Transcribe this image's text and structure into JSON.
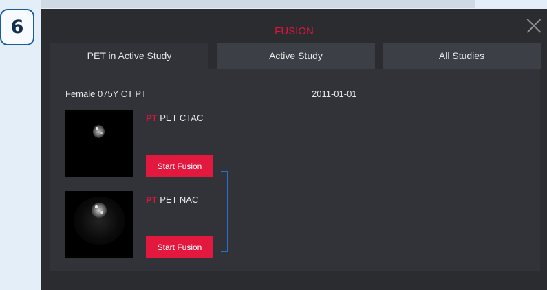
{
  "step": {
    "number": "6"
  },
  "dialog": {
    "title": "FUSION",
    "tabs": [
      {
        "label": "PET in Active Study",
        "active": true
      },
      {
        "label": "Active Study",
        "active": false
      },
      {
        "label": "All Studies",
        "active": false
      }
    ],
    "study": {
      "description": "Female 075Y CT PT",
      "date": "2011-01-01"
    },
    "series": [
      {
        "modality": "PT",
        "name": "PET CTAC",
        "button_label": "Start Fusion"
      },
      {
        "modality": "PT",
        "name": "PET NAC",
        "button_label": "Start Fusion"
      }
    ]
  },
  "colors": {
    "accent": "#e0143b",
    "bracket": "#2a6fd0",
    "badge_border": "#1a5aa0"
  },
  "icons": {
    "close": "close-icon"
  }
}
